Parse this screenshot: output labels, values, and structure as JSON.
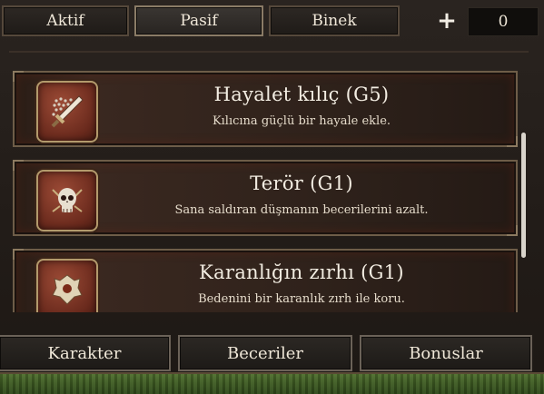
{
  "tabs": [
    {
      "label": "Aktif",
      "active": false
    },
    {
      "label": "Pasif",
      "active": true
    },
    {
      "label": "Binek",
      "active": false
    }
  ],
  "skill_points": {
    "plus_label": "+",
    "value": "0"
  },
  "skills": [
    {
      "title": "Hayalet kılıç (G5)",
      "description": "Kılıcına güçlü bir hayale ekle.",
      "icon": "ghost-sword-icon"
    },
    {
      "title": "Terör (G1)",
      "description": "Sana saldıran düşmanın becerilerini azalt.",
      "icon": "skull-icon"
    },
    {
      "title": "Karanlığın zırhı (G1)",
      "description": "Bedenini bir karanlık zırh ile koru.",
      "icon": "dark-armor-icon"
    }
  ],
  "bottom_buttons": {
    "karakter": "Karakter",
    "beceriler": "Beceriler",
    "bonuslar": "Bonuslar"
  },
  "colors": {
    "accent": "#8a7b66",
    "card_glow": "#7a2a18",
    "icon_bg": "#9b4a35"
  }
}
